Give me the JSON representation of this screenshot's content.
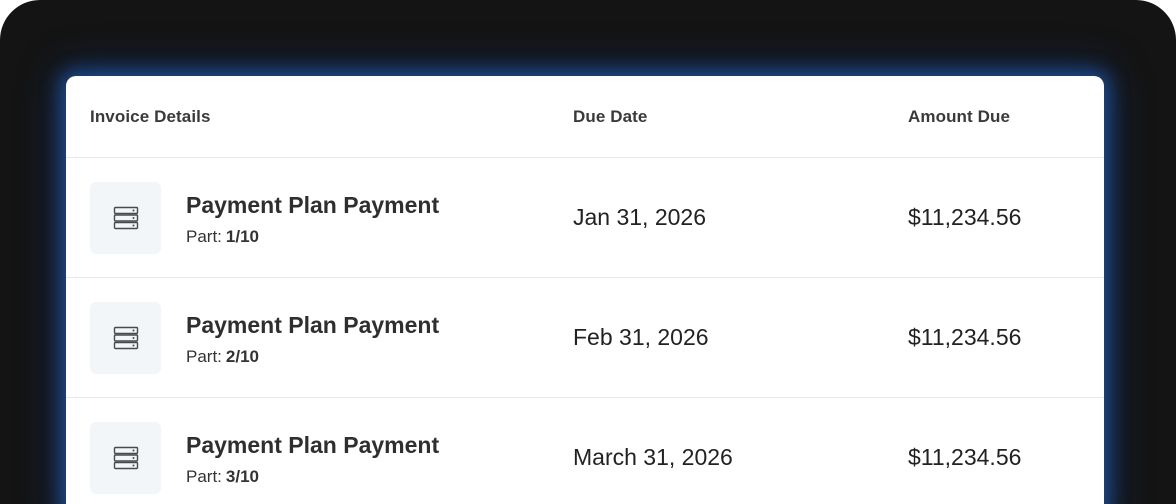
{
  "table": {
    "headers": {
      "details": "Invoice Details",
      "due_date": "Due Date",
      "amount_due": "Amount Due"
    },
    "rows": [
      {
        "icon": "server-icon",
        "title": "Payment Plan Payment",
        "part_label": "Part:",
        "part_value": "1/10",
        "due_date": "Jan 31, 2026",
        "amount": "$11,234.56"
      },
      {
        "icon": "server-icon",
        "title": "Payment Plan Payment",
        "part_label": "Part:",
        "part_value": "2/10",
        "due_date": "Feb 31, 2026",
        "amount": "$11,234.56"
      },
      {
        "icon": "server-icon",
        "title": "Payment Plan Payment",
        "part_label": "Part:",
        "part_value": "3/10",
        "due_date": "March 31, 2026",
        "amount": "$11,234.56"
      }
    ]
  },
  "colors": {
    "frame_background": "#141414",
    "card_background": "#ffffff",
    "glow": "#2868d0",
    "icon_box_background": "#f3f6f9",
    "divider": "#e6e8eb"
  }
}
